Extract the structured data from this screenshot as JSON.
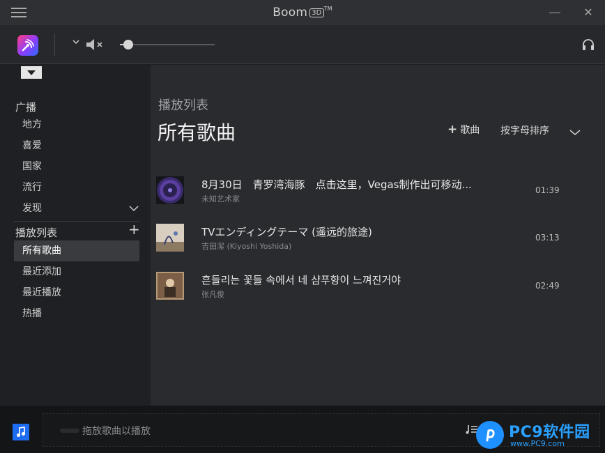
{
  "titlebar": {
    "app_name": "Boom",
    "badge": "3D",
    "trademark": "TM",
    "minimize_icon": "minimize-icon",
    "close_icon": "close-icon",
    "close_glyph": "✕"
  },
  "toolbar": {
    "volume": 0.05,
    "muted": true
  },
  "sidebar": {
    "radio_header": "广播",
    "radio_items": [
      {
        "label": "地方"
      },
      {
        "label": "喜爱"
      },
      {
        "label": "国家"
      },
      {
        "label": "流行"
      },
      {
        "label": "发现"
      }
    ],
    "playlist_header": "播放列表",
    "playlist_add": "+",
    "playlist_items": [
      {
        "label": "所有歌曲",
        "active": true
      },
      {
        "label": "最近添加"
      },
      {
        "label": "最近播放"
      },
      {
        "label": "热播"
      }
    ]
  },
  "main": {
    "subtitle": "播放列表",
    "title": "所有歌曲",
    "add_song_plus": "+",
    "add_song_label": "歌曲",
    "sort_label": "按字母排序",
    "songs": [
      {
        "title": "8月30日　青罗湾海豚　点击这里，Vegas制作出可移动...",
        "artist": "未知艺术家",
        "duration": "01:39"
      },
      {
        "title": "TVエンディングテーマ (遥远的旅途)",
        "artist": "吉田潔 (Kiyoshi Yoshida)",
        "duration": "03:13"
      },
      {
        "title": "흔들리는 꽃들 속에서 네 샴푸향이 느껴진거야",
        "artist": "张凡俊",
        "duration": "02:49"
      }
    ]
  },
  "bottombar": {
    "drop_text": "拖放歌曲以播放"
  },
  "watermark": {
    "text": "PC9软件园",
    "sub": "www.PC9.com"
  },
  "colors": {
    "accent": "#1e6cf0",
    "background": "#1e1f22",
    "main_panel": "#2a2b2e"
  }
}
